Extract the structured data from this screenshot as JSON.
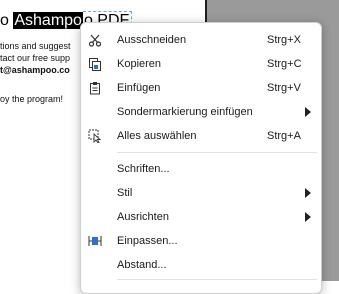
{
  "document": {
    "title_prefix": "o ",
    "title_selected": "Ashampo",
    "title_rest": "o PDF",
    "lines": [
      "tions and suggest",
      "tact our free supp",
      "t@ashampoo.co",
      "",
      "oy the program!"
    ]
  },
  "menu": {
    "items": [
      {
        "label": "Ausschneiden",
        "shortcut": "Strg+X",
        "icon": "scissors-icon"
      },
      {
        "label": "Kopieren",
        "shortcut": "Strg+C",
        "icon": "copy-icon"
      },
      {
        "label": "Einfügen",
        "shortcut": "Strg+V",
        "icon": "paste-icon"
      },
      {
        "label": "Sondermarkierung einfügen",
        "shortcut": "",
        "icon": ""
      },
      {
        "label": "Alles auswählen",
        "shortcut": "Strg+A",
        "icon": "select-all-icon"
      },
      {
        "label": "Schriften...",
        "shortcut": "",
        "icon": ""
      },
      {
        "label": "Stil",
        "shortcut": "",
        "icon": ""
      },
      {
        "label": "Ausrichten",
        "shortcut": "",
        "icon": ""
      },
      {
        "label": "Einpassen...",
        "shortcut": "",
        "icon": "fit-icon"
      },
      {
        "label": "Abstand...",
        "shortcut": "",
        "icon": ""
      }
    ]
  }
}
